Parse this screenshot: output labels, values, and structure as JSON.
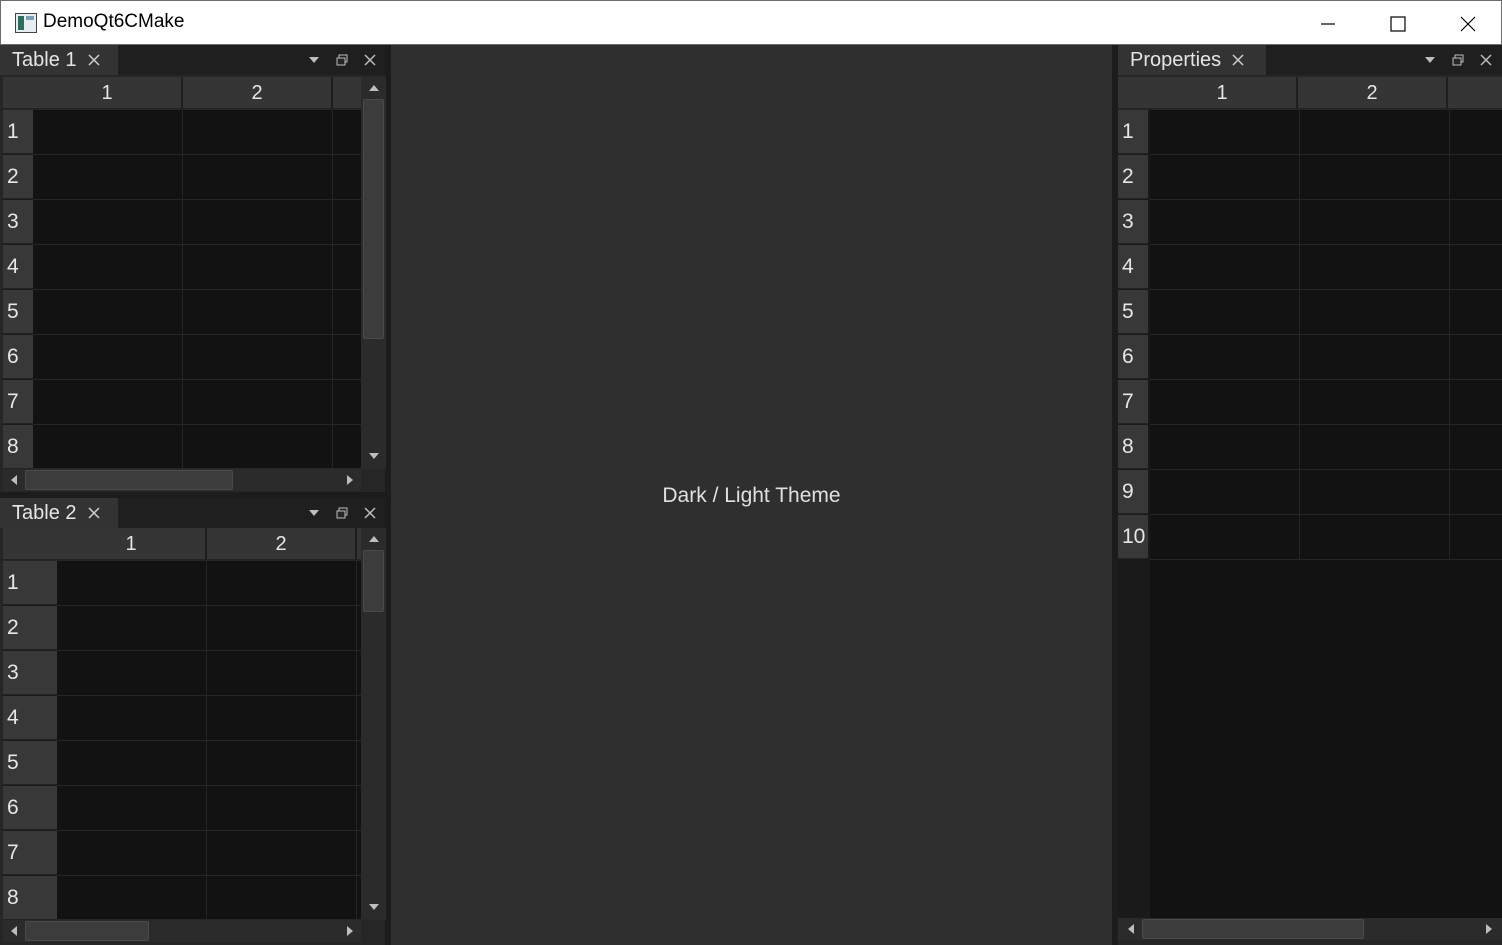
{
  "window": {
    "title": "DemoQt6CMake"
  },
  "central": {
    "label": "Dark / Light Theme"
  },
  "docks": {
    "table1": {
      "title": "Table 1",
      "columns": [
        "1",
        "2"
      ],
      "rows": [
        "1",
        "2",
        "3",
        "4",
        "5",
        "6",
        "7",
        "8"
      ]
    },
    "table2": {
      "title": "Table 2",
      "columns": [
        "1",
        "2"
      ],
      "rows": [
        "1",
        "2",
        "3",
        "4",
        "5",
        "6",
        "7",
        "8"
      ]
    },
    "properties": {
      "title": "Properties",
      "columns": [
        "1",
        "2"
      ],
      "rows": [
        "1",
        "2",
        "3",
        "4",
        "5",
        "6",
        "7",
        "8",
        "9",
        "10"
      ]
    }
  },
  "icons": {
    "tab_close": "close-icon",
    "dock_menu": "dropdown-arrow-icon",
    "dock_float": "float-window-icon",
    "dock_close": "close-icon"
  },
  "colors": {
    "background": "#2b2b2b",
    "grid": "#121212",
    "header": "#353535",
    "text": "#e6e6e6"
  }
}
